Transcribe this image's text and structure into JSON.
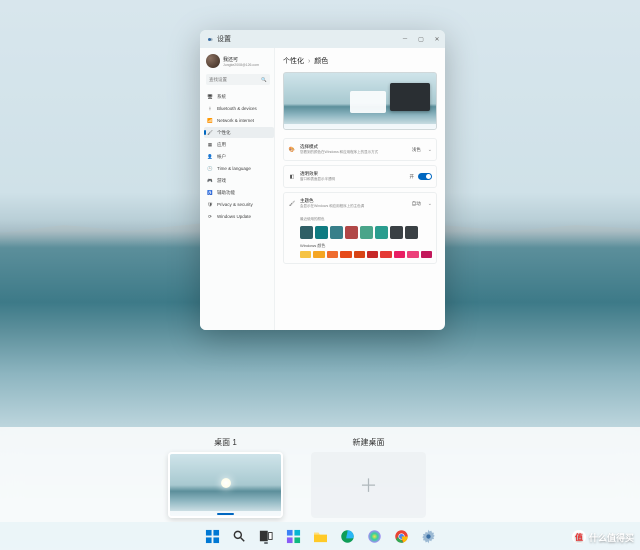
{
  "window": {
    "title": "设置",
    "user": {
      "name": "我还可",
      "email": "Jungke2008@126.com"
    },
    "search_placeholder": "查找设置",
    "nav": [
      {
        "label": "系统",
        "icon": "monitor"
      },
      {
        "label": "Bluetooth & devices",
        "icon": "bluetooth"
      },
      {
        "label": "Network & internet",
        "icon": "wifi"
      },
      {
        "label": "个性化",
        "icon": "brush",
        "active": true
      },
      {
        "label": "应用",
        "icon": "apps"
      },
      {
        "label": "帐户",
        "icon": "person"
      },
      {
        "label": "Time & language",
        "icon": "clock"
      },
      {
        "label": "游戏",
        "icon": "gamepad"
      },
      {
        "label": "辅助功能",
        "icon": "accessibility"
      },
      {
        "label": "Privacy & security",
        "icon": "shield"
      },
      {
        "label": "Windows Update",
        "icon": "update"
      }
    ],
    "breadcrumb": {
      "parent": "个性化",
      "current": "颜色"
    },
    "rows": {
      "mode": {
        "title": "选择模式",
        "subtitle": "您看到的颜色在Windows 和应用程序上的显示方式",
        "value": "浅色"
      },
      "transparency": {
        "title": "透明效果",
        "subtitle": "窗口和表面显示半透明",
        "value": "开"
      },
      "accent": {
        "title": "主题色",
        "subtitle": "会显示在Windows 和应用程序上的主色调",
        "value": "自动"
      },
      "recent_label": "最近使用的颜色",
      "windows_label": "Windows 颜色"
    },
    "recent_colors": [
      "#2f5f66",
      "#0f7b81",
      "#387f8a",
      "#b14747",
      "#4aa58a",
      "#2a9d8f",
      "#3a4044",
      "#3a4044"
    ],
    "windows_colors": [
      "#f6c344",
      "#f5a623",
      "#ef6c2f",
      "#e64a19",
      "#d84315",
      "#c62828",
      "#e53935",
      "#e91e63",
      "#ec407a",
      "#c2185b"
    ]
  },
  "taskview": {
    "desktop_label": "桌面 1",
    "new_desktop_label": "新建桌面"
  },
  "watermark": "什么值得买"
}
